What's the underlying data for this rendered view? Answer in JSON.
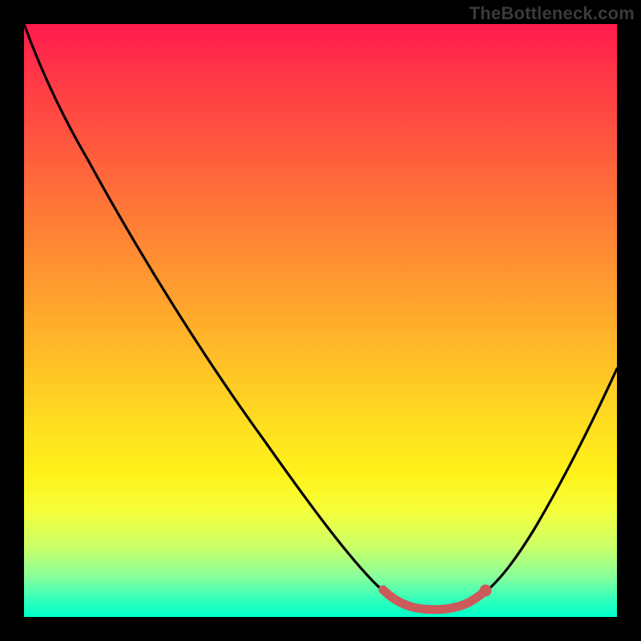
{
  "watermark": "TheBottleneck.com",
  "chart_data": {
    "type": "line",
    "title": "",
    "xlabel": "",
    "ylabel": "",
    "xlim": [
      0,
      100
    ],
    "ylim": [
      0,
      100
    ],
    "grid": false,
    "legend": false,
    "background_gradient": {
      "orientation": "vertical",
      "stops": [
        {
          "pos": 0.0,
          "color": "#ff1a4d"
        },
        {
          "pos": 0.5,
          "color": "#ffc326"
        },
        {
          "pos": 0.8,
          "color": "#fff21a"
        },
        {
          "pos": 1.0,
          "color": "#00ffcc"
        }
      ]
    },
    "series": [
      {
        "name": "bottleneck-curve",
        "color": "#000000",
        "x": [
          0,
          5,
          10,
          15,
          20,
          25,
          30,
          35,
          40,
          45,
          50,
          55,
          60,
          62,
          65,
          68,
          72,
          75,
          78,
          80,
          84,
          88,
          92,
          96,
          100
        ],
        "y": [
          100,
          95,
          89,
          82,
          75,
          67,
          59,
          51,
          43,
          35,
          27,
          19,
          11,
          8,
          5,
          3,
          1.5,
          1.5,
          3,
          5,
          10,
          17,
          25,
          33,
          42
        ]
      },
      {
        "name": "optimal-highlight",
        "color": "#cc5a5a",
        "x": [
          61,
          63,
          65,
          67,
          69,
          71,
          73,
          75,
          77
        ],
        "y": [
          8,
          6,
          5,
          3.5,
          2.5,
          2,
          1.8,
          2,
          3
        ]
      }
    ],
    "annotations": [
      {
        "type": "point",
        "name": "highlight-end-dot",
        "x": 77,
        "y": 3,
        "color": "#cc5a5a",
        "radius": 6
      }
    ]
  }
}
